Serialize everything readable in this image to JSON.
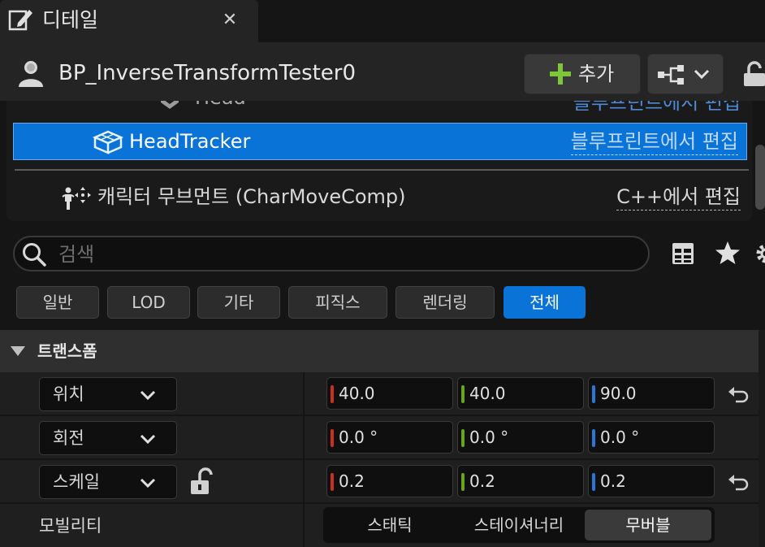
{
  "tab": {
    "title": "디테일",
    "close": "✕"
  },
  "header": {
    "name": "BP_InverseTransformTester0",
    "add_label": "추가"
  },
  "tree": {
    "partial_row": {
      "label": "Head",
      "edit": "블루프린트에서 편집"
    },
    "selected_row": {
      "label": "HeadTracker",
      "edit": "블루프린트에서 편집"
    },
    "movement_row": {
      "label": "캐릭터 무브먼트 (CharMoveComp)",
      "edit": "C++에서 편집"
    }
  },
  "search": {
    "placeholder": "검색",
    "value": ""
  },
  "filters": [
    "일반",
    "LOD",
    "기타",
    "피직스",
    "렌더링",
    "전체"
  ],
  "active_filter": "전체",
  "section": {
    "title": "트랜스폼"
  },
  "properties": {
    "location": {
      "label": "위치",
      "x": "40.0",
      "y": "40.0",
      "z": "90.0"
    },
    "rotation": {
      "label": "회전",
      "x": "0.0 °",
      "y": "0.0 °",
      "z": "0.0 °"
    },
    "scale": {
      "label": "스케일",
      "x": "0.2",
      "y": "0.2",
      "z": "0.2"
    },
    "mobility": {
      "label": "모빌리티",
      "options": [
        "스태틱",
        "스테이셔너리",
        "무버블"
      ],
      "selected": "무버블"
    }
  },
  "colors": {
    "accent": "#0a73d8",
    "axis_x": "#c7311d",
    "axis_y": "#6aa31d",
    "axis_z": "#2a76d6",
    "add_plus": "#7ec63a"
  },
  "icons": {
    "tab": "edit-pencil-icon",
    "avatar": "actor-icon",
    "add": "plus-icon",
    "hierarchy": "hierarchy-icon",
    "lock": "lock-icon",
    "component": "cube-icon",
    "movement": "character-movement-icon",
    "search": "search-icon",
    "table": "table-icon",
    "favorite": "star-icon",
    "settings": "gear-icon",
    "reset": "reset-arrow-icon",
    "collapse": "triangle-down-icon",
    "dropdown": "chevron-down-icon"
  }
}
